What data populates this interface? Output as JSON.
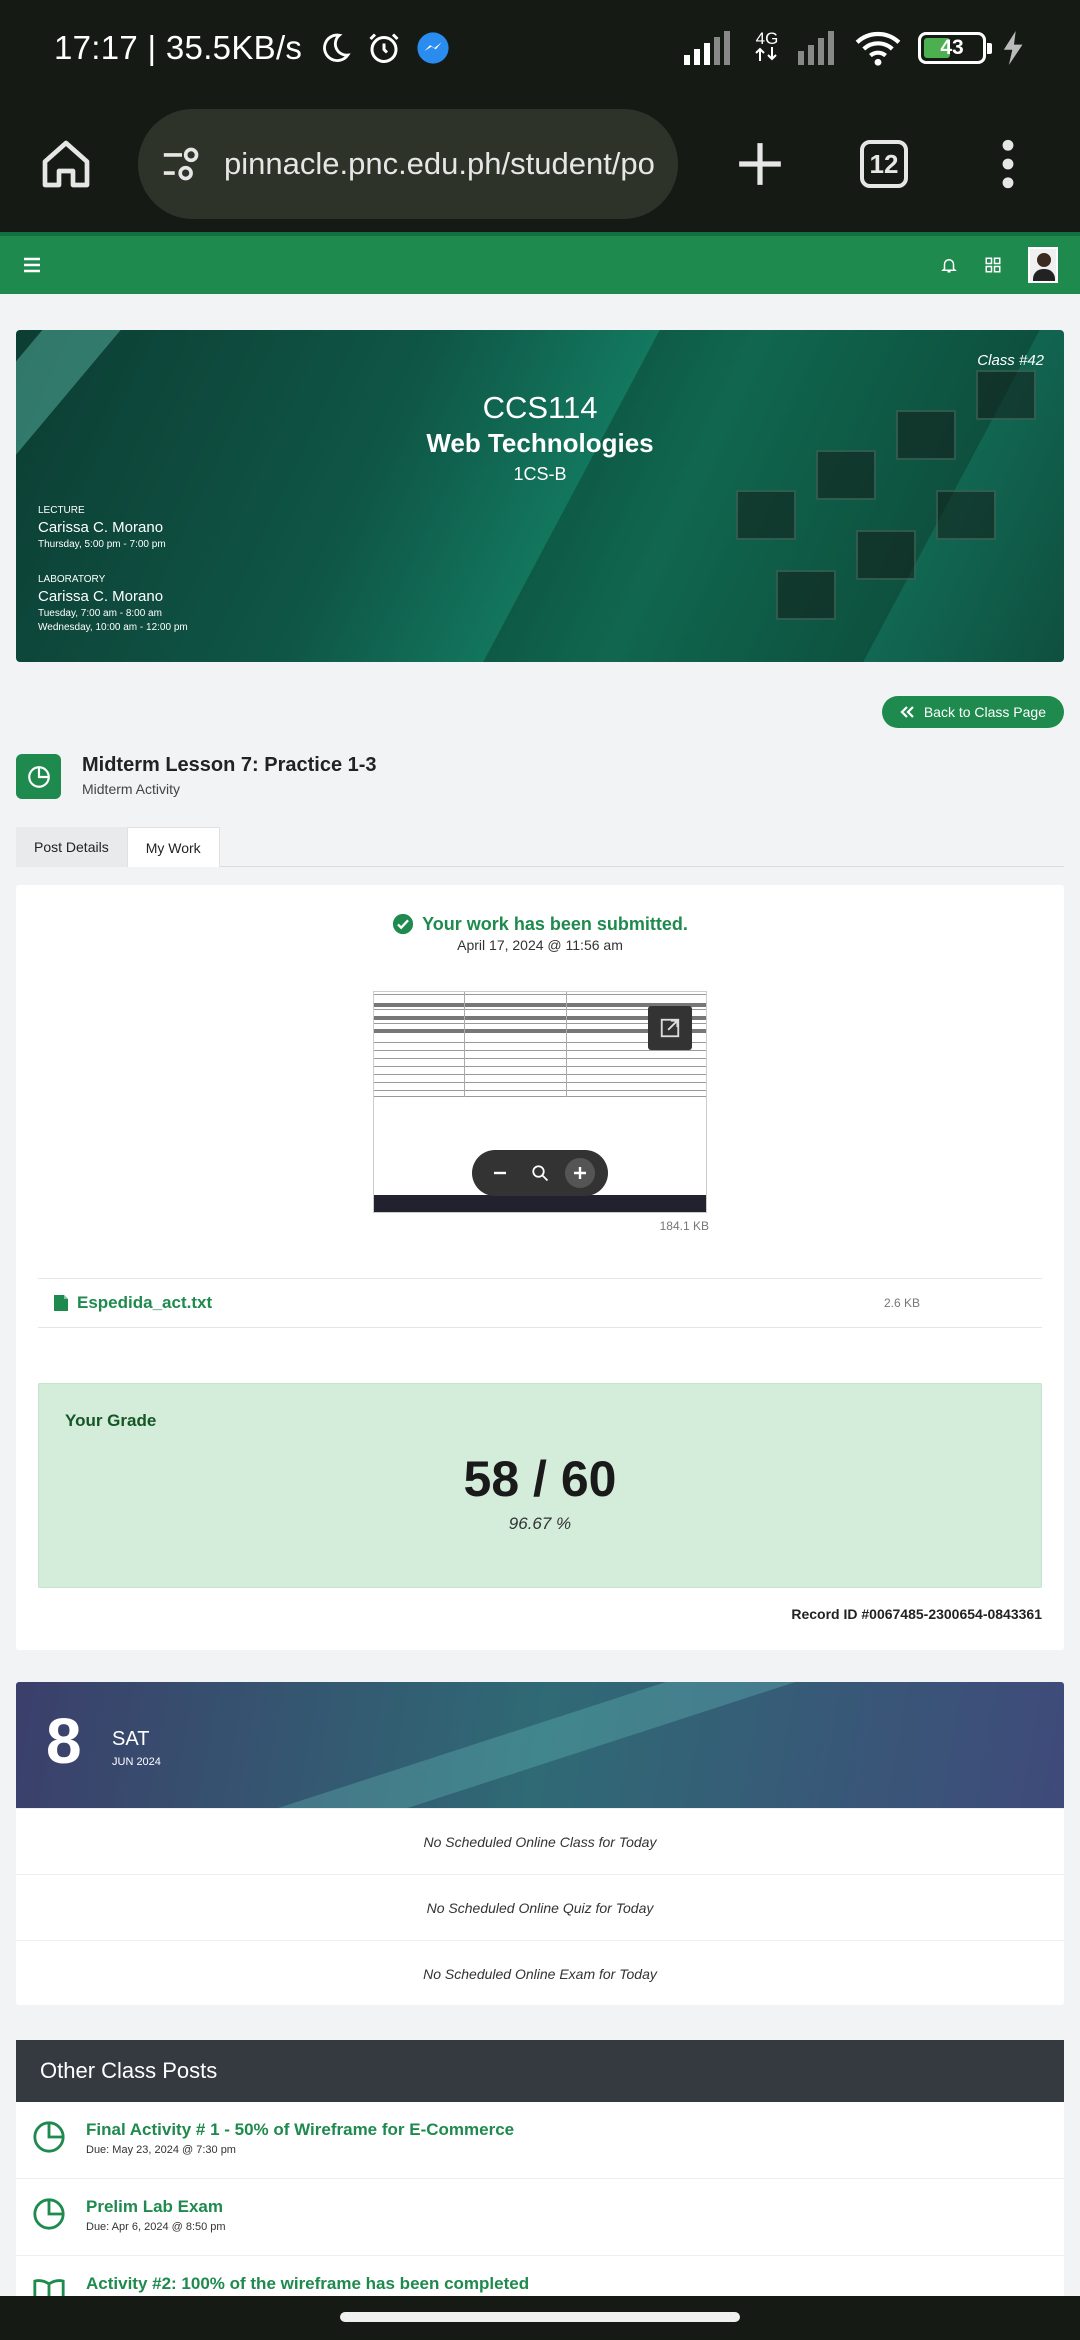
{
  "status_bar": {
    "time": "17:17 | 35.5KB/s",
    "network_type": "4G",
    "battery_level": "43"
  },
  "browser": {
    "url": "pinnacle.pnc.edu.ph/student/pos",
    "tab_count": "12"
  },
  "banner": {
    "class_number": "Class #42",
    "course_code": "CCS114",
    "course_title": "Web Technologies",
    "section": "1CS-B",
    "lecture": {
      "label": "LECTURE",
      "instructor": "Carissa C. Morano",
      "schedule": "Thursday, 5:00 pm - 7:00 pm"
    },
    "laboratory": {
      "label": "LABORATORY",
      "instructor": "Carissa C. Morano",
      "schedule_1": "Tuesday, 7:00 am - 8:00 am",
      "schedule_2": "Wednesday, 10:00 am - 12:00 pm"
    }
  },
  "activity": {
    "back_label": "Back to Class Page",
    "title": "Midterm Lesson 7: Practice 1-3",
    "subtitle": "Midterm Activity",
    "tabs": [
      {
        "label": "Post Details"
      },
      {
        "label": "My Work"
      }
    ]
  },
  "work": {
    "submitted_text": "Your work has been submitted.",
    "submitted_date": "April 17, 2024 @ 11:56 am",
    "preview_size": "184.1 KB",
    "file_name": "Espedida_act.txt",
    "file_size": "2.6 KB",
    "grade_label": "Your Grade",
    "grade_score": "58 / 60",
    "grade_percent": "96.67 %",
    "record_id": "Record ID #0067485-2300654-0843361"
  },
  "calendar": {
    "day": "8",
    "weekday": "SAT",
    "month_year": "JUN 2024",
    "items": [
      "No Scheduled Online Class for Today",
      "No Scheduled Online Quiz for Today",
      "No Scheduled Online Exam for Today"
    ]
  },
  "other_posts": {
    "heading": "Other Class Posts",
    "items": [
      {
        "title": "Final Activity # 1 - 50% of Wireframe for E-Commerce",
        "due": "Due: May 23, 2024 @ 7:30 pm",
        "icon": "activity-icon"
      },
      {
        "title": "Prelim Lab Exam",
        "due": "Due: Apr 6, 2024 @ 8:50 pm",
        "icon": "activity-icon"
      },
      {
        "title": "Activity #2: 100% of the wireframe has been completed",
        "due": "",
        "icon": "book-icon"
      }
    ]
  },
  "colors": {
    "brand_green": "#1e8a4d",
    "dark_header": "#343a40",
    "grade_bg": "#d4ecda"
  }
}
